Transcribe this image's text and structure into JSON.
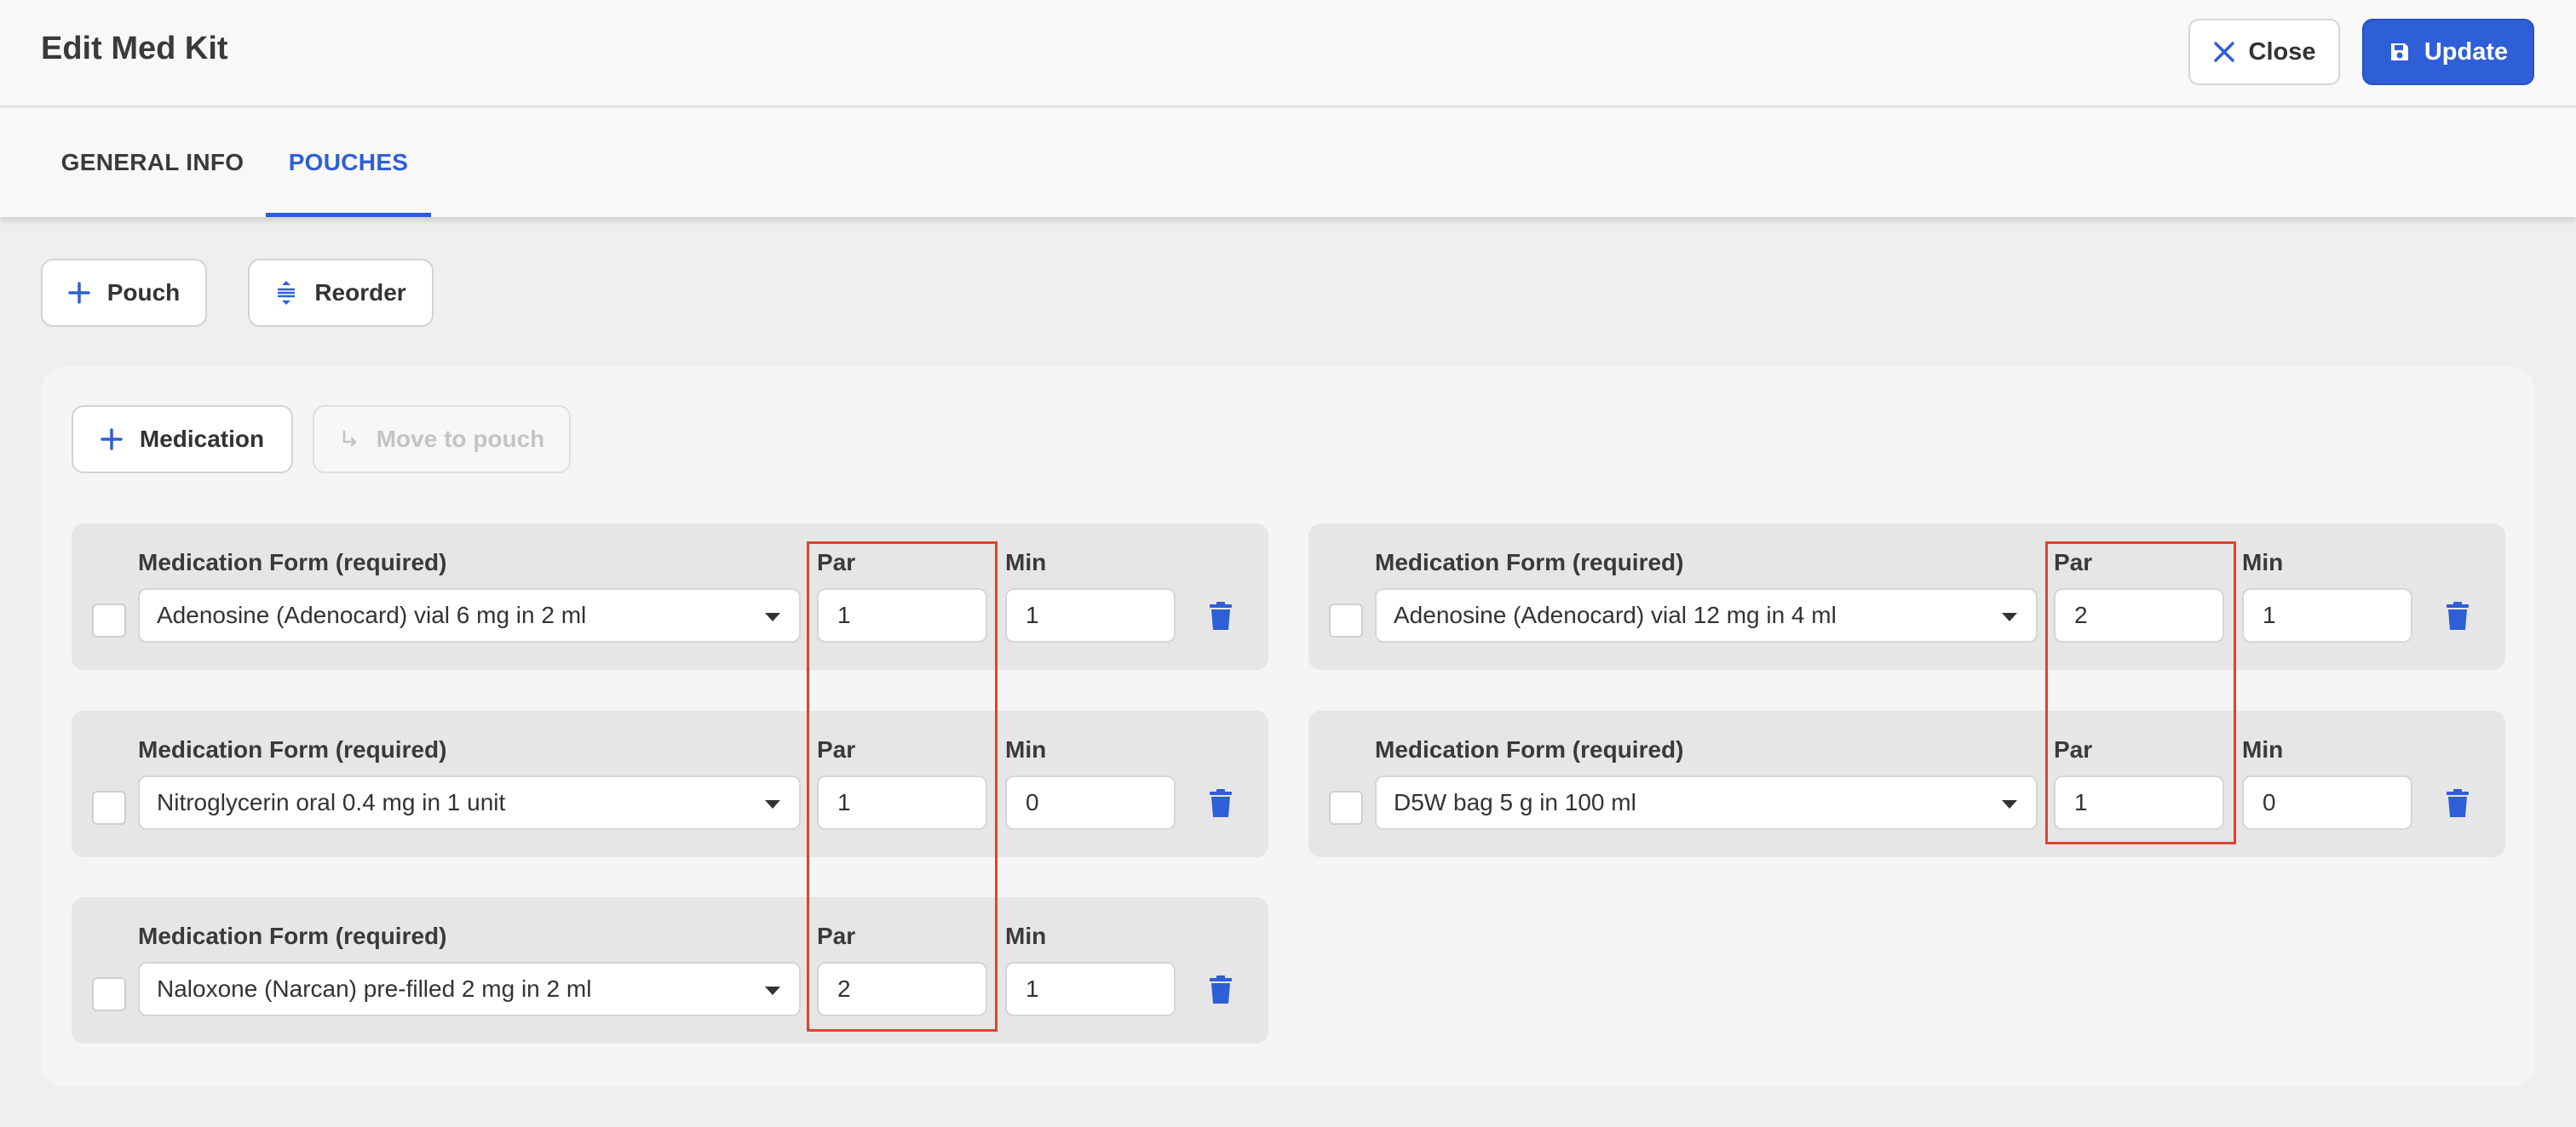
{
  "header": {
    "title": "Edit Med Kit",
    "close_label": "Close",
    "update_label": "Update"
  },
  "tabs": [
    {
      "label": "GENERAL INFO",
      "active": false
    },
    {
      "label": "POUCHES",
      "active": true
    }
  ],
  "toolbar": {
    "pouch_label": "Pouch",
    "reorder_label": "Reorder"
  },
  "pouch": {
    "medication_label": "Medication",
    "move_label": "Move to pouch",
    "items": [
      {
        "form_label": "Medication Form (required)",
        "form_value": "Adenosine (Adenocard) vial 6 mg in 2 ml",
        "par_label": "Par",
        "par": "1",
        "min_label": "Min",
        "min": "1"
      },
      {
        "form_label": "Medication Form (required)",
        "form_value": "Adenosine (Adenocard) vial 12 mg in 4 ml",
        "par_label": "Par",
        "par": "2",
        "min_label": "Min",
        "min": "1"
      },
      {
        "form_label": "Medication Form (required)",
        "form_value": "Nitroglycerin oral 0.4 mg in 1 unit",
        "par_label": "Par",
        "par": "1",
        "min_label": "Min",
        "min": "0"
      },
      {
        "form_label": "Medication Form (required)",
        "form_value": "D5W bag 5 g in 100 ml",
        "par_label": "Par",
        "par": "1",
        "min_label": "Min",
        "min": "0"
      },
      {
        "form_label": "Medication Form (required)",
        "form_value": "Naloxone (Narcan) pre-filled 2 mg in 2 ml",
        "par_label": "Par",
        "par": "2",
        "min_label": "Min",
        "min": "1"
      }
    ]
  },
  "colors": {
    "accent": "#2f5fd6",
    "highlight": "#e0442b",
    "card_bg": "#e6e6e6"
  },
  "icons": {
    "close": "close-icon",
    "update": "save-icon",
    "pouch": "plus-icon",
    "reorder": "reorder-icon",
    "medication": "plus-icon",
    "move": "move-arrow-icon",
    "delete": "trash-icon"
  }
}
